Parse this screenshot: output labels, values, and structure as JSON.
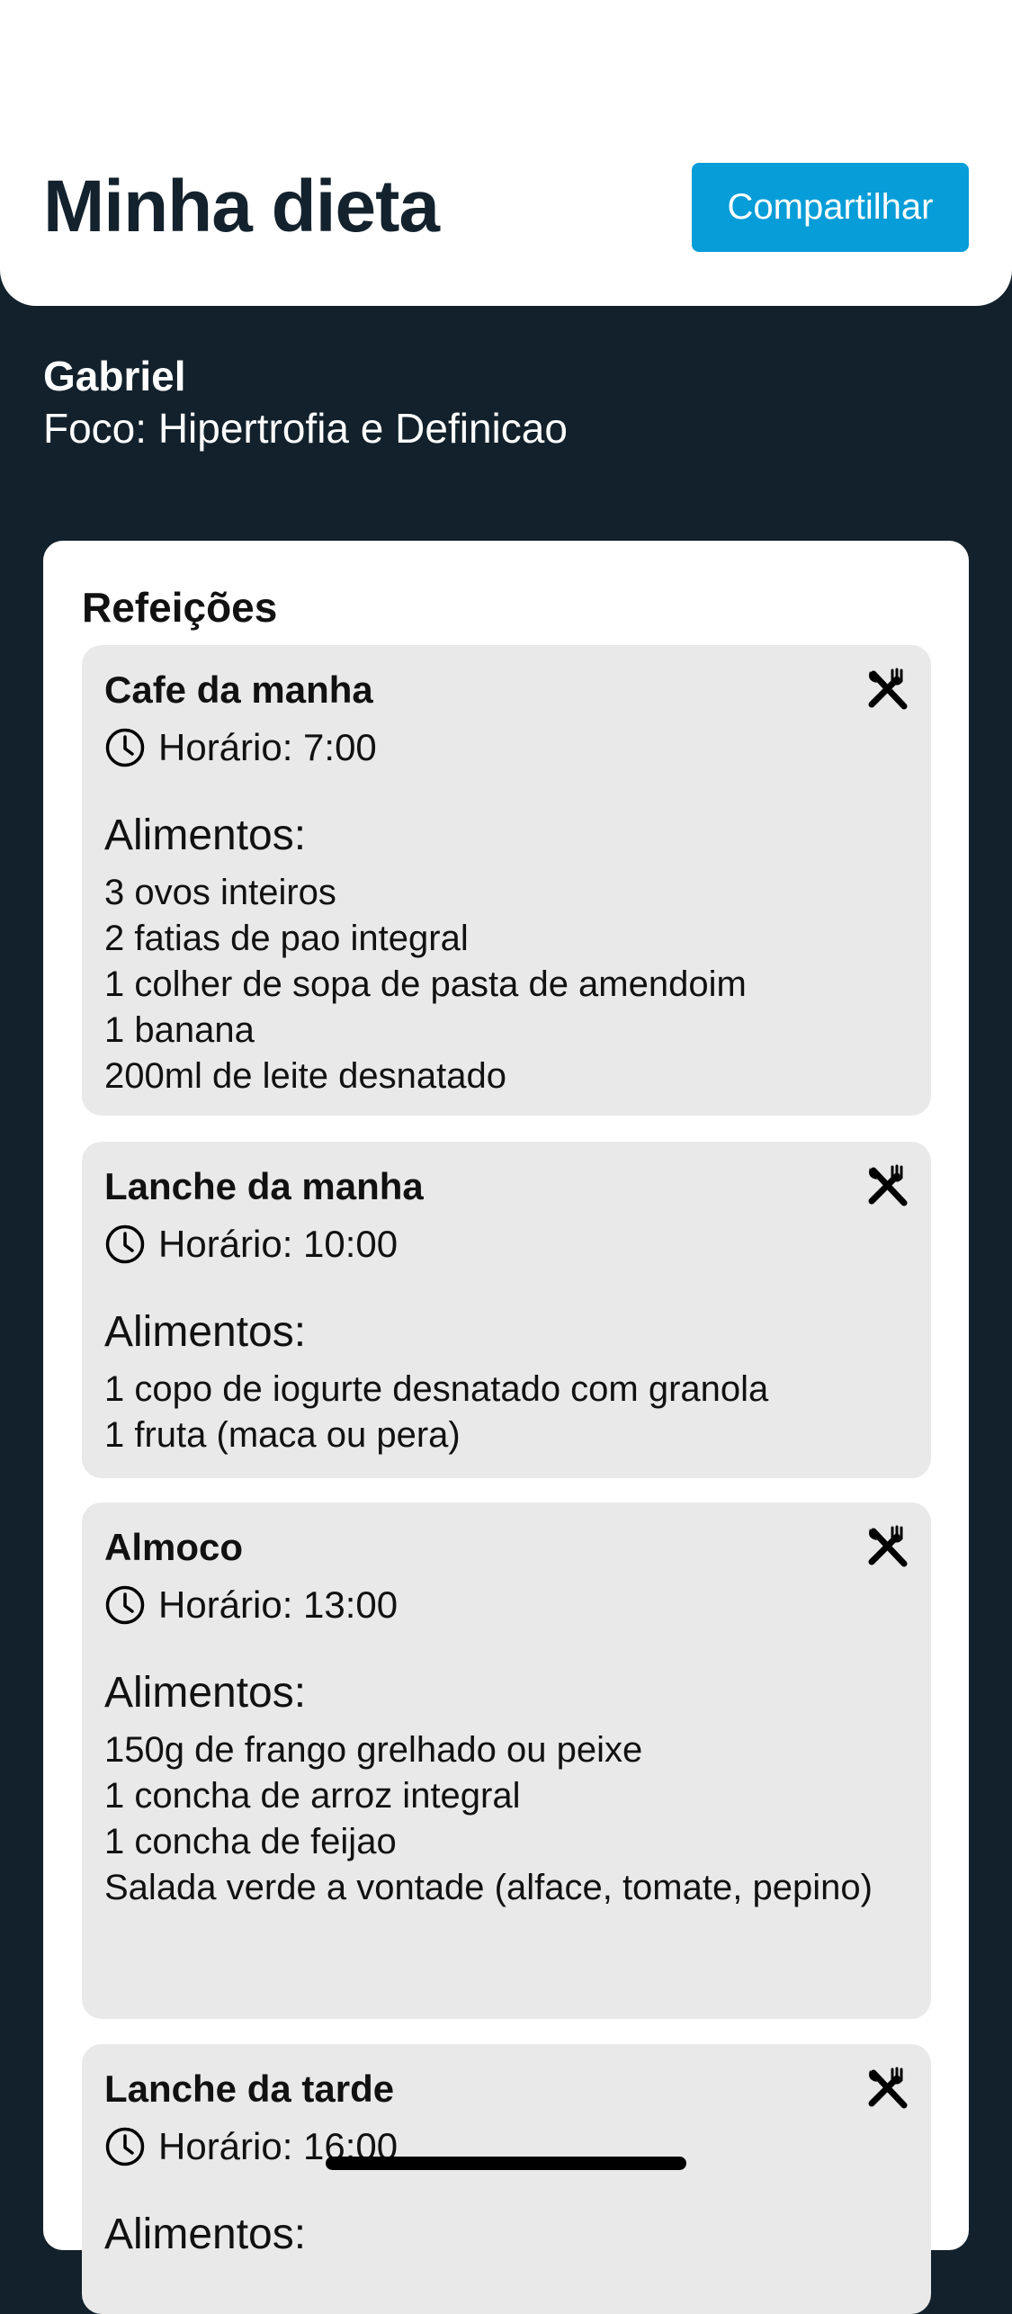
{
  "header": {
    "title": "Minha dieta",
    "share_label": "Compartilhar"
  },
  "user": {
    "name": "Gabriel",
    "focus": "Foco: Hipertrofia e Definicao"
  },
  "meals": {
    "title": "Refeições",
    "items": [
      {
        "name": "Cafe da manha",
        "time": "Horário: 7:00",
        "foods_label": "Alimentos:",
        "foods": [
          "3 ovos inteiros",
          "2 fatias de pao integral",
          "1 colher de sopa de pasta de amendoim",
          "1 banana",
          "200ml de leite desnatado"
        ]
      },
      {
        "name": "Lanche da manha",
        "time": "Horário: 10:00",
        "foods_label": "Alimentos:",
        "foods": [
          "1 copo de iogurte desnatado com granola",
          "1 fruta (maca ou pera)"
        ]
      },
      {
        "name": "Almoco",
        "time": "Horário: 13:00",
        "foods_label": "Alimentos:",
        "foods": [
          "150g de frango grelhado ou peixe",
          "1 concha de arroz integral",
          "1 concha de feijao",
          "Salada verde a vontade (alface, tomate, pepino)"
        ]
      },
      {
        "name": "Lanche da tarde",
        "time": "Horário: 16:00",
        "foods_label": "Alimentos:",
        "foods": []
      }
    ]
  },
  "icons": {
    "meal": "utensils-crossed-icon",
    "time": "clock-icon"
  },
  "colors": {
    "background": "#12212b",
    "accent": "#079dd8",
    "card": "#e9e9e9"
  }
}
